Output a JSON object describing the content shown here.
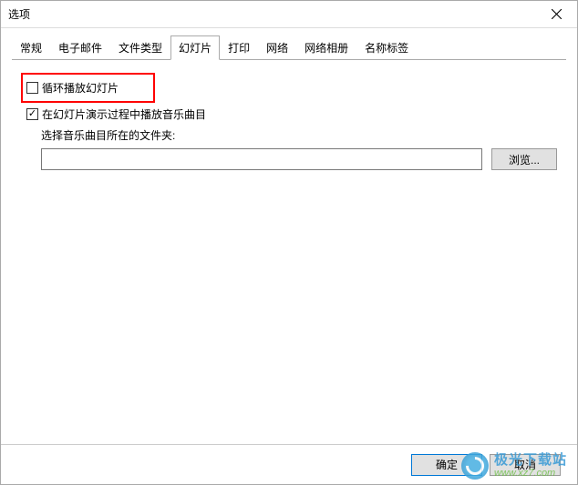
{
  "window": {
    "title": "选项"
  },
  "tabs": [
    {
      "label": "常规"
    },
    {
      "label": "电子邮件"
    },
    {
      "label": "文件类型"
    },
    {
      "label": "幻灯片"
    },
    {
      "label": "打印"
    },
    {
      "label": "网络"
    },
    {
      "label": "网络相册"
    },
    {
      "label": "名称标签"
    }
  ],
  "active_tab_index": 3,
  "slideshow": {
    "loop_checkbox": {
      "label": "循环播放幻灯片",
      "checked": false,
      "highlighted": true
    },
    "play_music_checkbox": {
      "label": "在幻灯片演示过程中播放音乐曲目",
      "checked": true
    },
    "folder_label": "选择音乐曲目所在的文件夹:",
    "folder_path": "",
    "browse_label": "浏览..."
  },
  "footer": {
    "ok_label": "确定",
    "cancel_label": "取消"
  },
  "watermark": {
    "name": "极光下载站",
    "url": "www.xz7.com"
  }
}
